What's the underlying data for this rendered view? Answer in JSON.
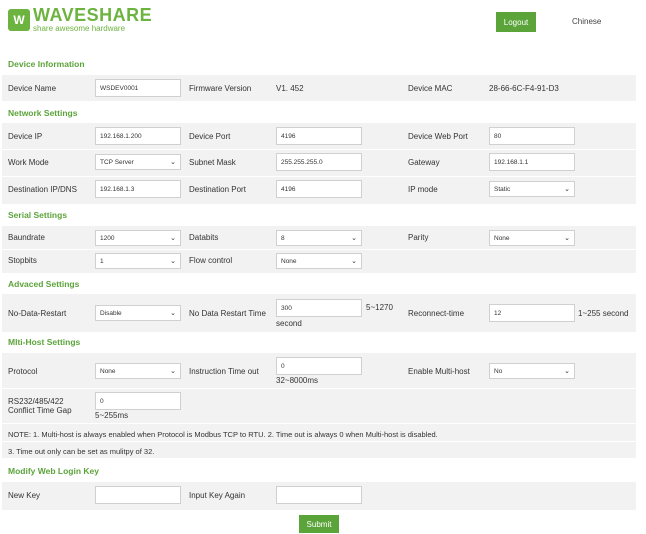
{
  "header": {
    "logo_mark": "W",
    "logo_main": "WAVESHARE",
    "logo_sub": "share awesome hardware",
    "logout_label": "Logout",
    "language_label": "Chinese"
  },
  "device_info": {
    "title": "Device Information",
    "device_name_label": "Device Name",
    "device_name_value": "WSDEV0001",
    "firmware_label": "Firmware Version",
    "firmware_value": "V1. 452",
    "mac_label": "Device MAC",
    "mac_value": "28-66-6C-F4-91-D3"
  },
  "network": {
    "title": "Network Settings",
    "device_ip_label": "Device IP",
    "device_ip_value": "192.168.1.200",
    "device_port_label": "Device Port",
    "device_port_value": "4196",
    "web_port_label": "Device Web Port",
    "web_port_value": "80",
    "work_mode_label": "Work Mode",
    "work_mode_value": "TCP Server",
    "subnet_label": "Subnet Mask",
    "subnet_value": "255.255.255.0",
    "gateway_label": "Gateway",
    "gateway_value": "192.168.1.1",
    "dest_ip_label": "Destination IP/DNS",
    "dest_ip_value": "192.168.1.3",
    "dest_port_label": "Destination Port",
    "dest_port_value": "4196",
    "ip_mode_label": "IP mode",
    "ip_mode_value": "Static"
  },
  "serial": {
    "title": "Serial Settings",
    "baud_label": "Baundrate",
    "baud_value": "1200",
    "databits_label": "Databits",
    "databits_value": "8",
    "parity_label": "Parity",
    "parity_value": "None",
    "stopbits_label": "Stopbits",
    "stopbits_value": "1",
    "flow_label": "Flow control",
    "flow_value": "None"
  },
  "advanced": {
    "title": "Advaced Settings",
    "ndr_label": "No-Data-Restart",
    "ndr_value": "Disable",
    "ndr_time_label": "No Data Restart Time",
    "ndr_time_value": "300",
    "ndr_time_range": "5~1270",
    "ndr_time_unit": "second",
    "reconnect_label": "Reconnect-time",
    "reconnect_value": "12",
    "reconnect_range": "1~255 second"
  },
  "multihost": {
    "title": "Mlti-Host Settings",
    "protocol_label": "Protocol",
    "protocol_value": "None",
    "timeout_label": "Instruction Time out",
    "timeout_value": "0",
    "timeout_range": "32~8000ms",
    "enable_label": "Enable Multi-host",
    "enable_value": "No",
    "gap_label_1": "RS232/485/422",
    "gap_label_2": "Conflict Time Gap",
    "gap_value": "0",
    "gap_range": "5~255ms",
    "note_1": "NOTE: 1. Multi-host is always enabled when Protocol is Modbus TCP to RTU. 2. Time out is always 0 when Multi-host is disabled.",
    "note_2": "3. Time out only can be set as mulitpy of 32."
  },
  "login": {
    "title": "Modify Web Login Key",
    "new_key_label": "New Key",
    "new_key_value": "",
    "again_label": "Input Key Again",
    "again_value": ""
  },
  "submit_label": "Submit",
  "colors": {
    "accent": "#5ba43a",
    "band": "#f2f2f2"
  }
}
